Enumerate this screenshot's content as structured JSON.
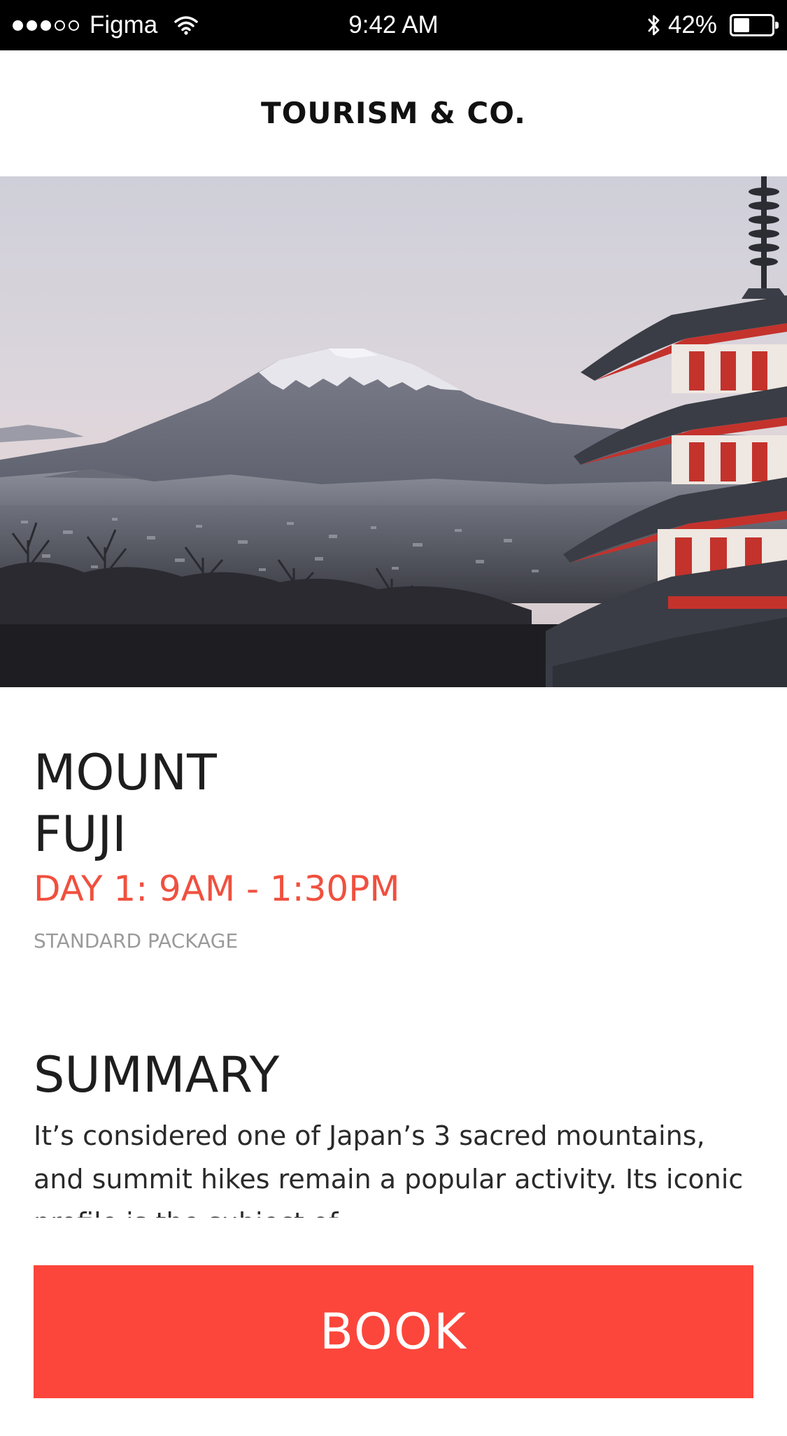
{
  "status_bar": {
    "carrier": "Figma",
    "signal_strength": 3,
    "signal_max": 5,
    "time": "9:42 AM",
    "battery_text": "42%",
    "battery_level": 0.42,
    "icons": [
      "signal-dots-icon",
      "wifi-icon",
      "bluetooth-icon",
      "battery-icon"
    ]
  },
  "header": {
    "title": "TOURISM & CO."
  },
  "hero": {
    "image_subject": "mount-fuji-with-pagoda"
  },
  "place": {
    "title_line1": "MOUNT",
    "title_line2": "FUJI",
    "schedule": "DAY 1: 9AM - 1:30PM",
    "package": "STANDARD PACKAGE"
  },
  "summary": {
    "title": "SUMMARY",
    "body": "It’s considered one of Japan’s 3 sacred mountains, and summit hikes remain a popular activity. Its iconic profile is the subject of"
  },
  "book_button": {
    "label": "BOOK"
  },
  "colors": {
    "accent": "#fc463b",
    "schedule": "#f0503f",
    "status_bar_bg": "#000000",
    "muted_text": "#9a9a9a"
  }
}
